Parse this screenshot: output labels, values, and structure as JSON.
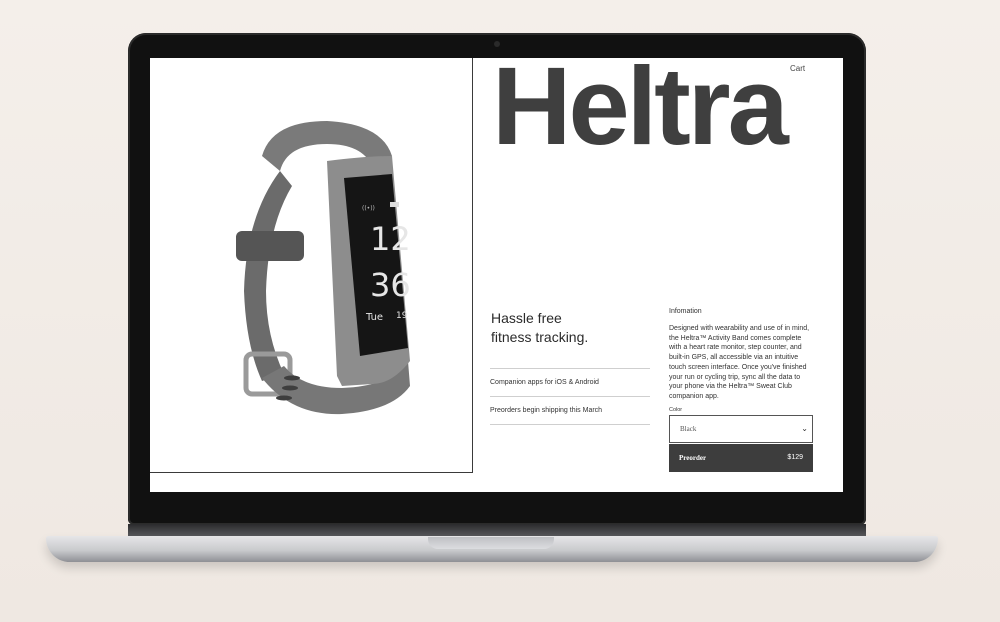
{
  "site": {
    "cart_label": "Cart",
    "brand": "Heltra"
  },
  "product": {
    "image_icon": "fitness-band",
    "display": {
      "hour": "12",
      "minute": "36",
      "day": "Tue",
      "date": "19"
    }
  },
  "hero": {
    "tagline_line1": "Hassle free",
    "tagline_line2": "fitness tracking."
  },
  "features": [
    "Companion apps for iOS & Android",
    "Preorders begin shipping this March"
  ],
  "info": {
    "label": "Infomation",
    "description": "Designed with wearability and use of in mind, the Heltra™ Activity Band comes complete with a heart rate monitor, step counter, and built-in GPS, all accessible via an intuitive touch screen interface. Once you've finished your run or cycling trip, sync all the data to your phone via the Heltra™ Sweat Club companion app."
  },
  "purchase": {
    "color_label": "Color",
    "color_selected": "Black",
    "button_label": "Preorder",
    "price": "$129"
  },
  "colors": {
    "accent_dark": "#3d3d3d",
    "band_gray": "#5f5f5f"
  }
}
